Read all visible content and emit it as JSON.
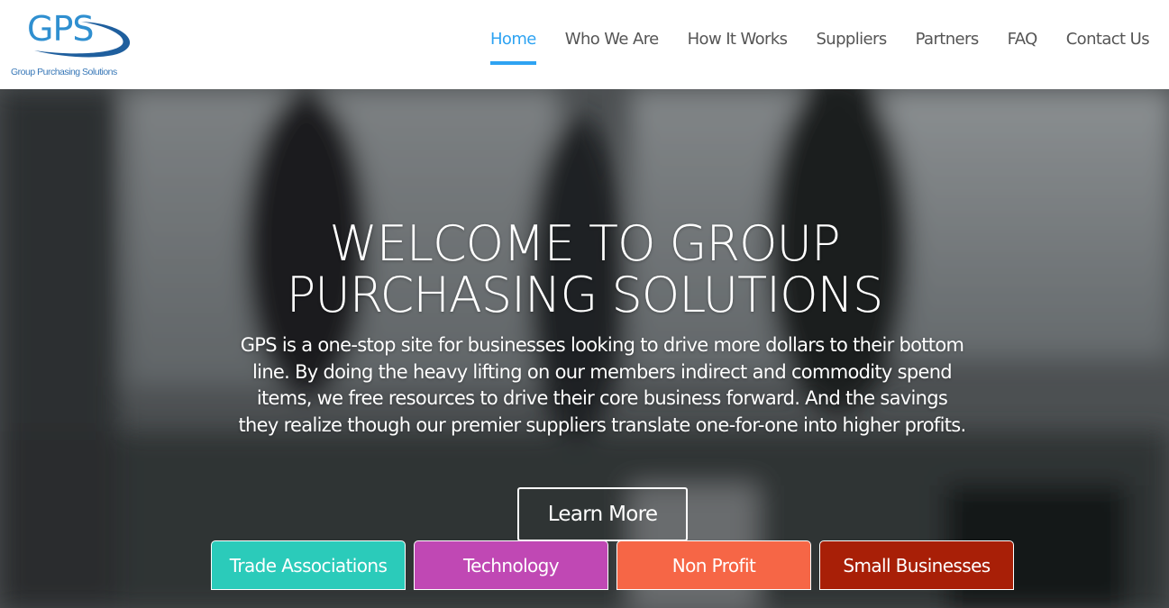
{
  "logo": {
    "title": "GPS",
    "subtitle": "Group Purchasing Solutions",
    "color": "#2f8fd0"
  },
  "nav": {
    "items": [
      {
        "label": "Home",
        "active": true
      },
      {
        "label": "Who We Are",
        "active": false
      },
      {
        "label": "How It Works",
        "active": false
      },
      {
        "label": "Suppliers",
        "active": false
      },
      {
        "label": "Partners",
        "active": false
      },
      {
        "label": "FAQ",
        "active": false
      },
      {
        "label": "Contact Us",
        "active": false
      }
    ],
    "active_color": "#2ea3f2"
  },
  "hero": {
    "title_line1": "WELCOME TO GROUP",
    "title_line2": "PURCHASING SOLUTIONS",
    "description": "GPS is a one-stop site for businesses looking to drive more dollars to their bottom line. By doing the heavy lifting on our members indirect and commodity spend items, we free resources to drive their core business forward. And the savings they realize though our premier suppliers translate one-for-one into higher profits.",
    "cta_label": "Learn More"
  },
  "categories": [
    {
      "label": "Trade Associations",
      "color": "#2bcbba"
    },
    {
      "label": "Technology",
      "color": "#c048b4"
    },
    {
      "label": "Non Profit",
      "color": "#f66646"
    },
    {
      "label": "Small Businesses",
      "color": "#a81f07"
    }
  ]
}
